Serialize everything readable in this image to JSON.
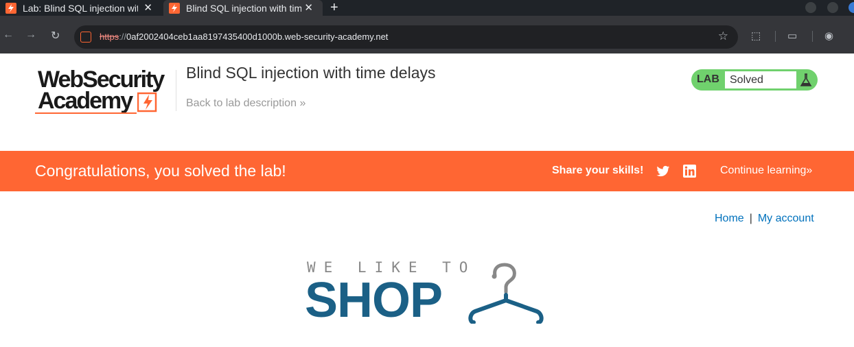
{
  "browser": {
    "tabs": [
      {
        "title": "Lab: Blind SQL injection with time delays",
        "active": false
      },
      {
        "title": "Blind SQL injection with time delays",
        "active": true
      }
    ],
    "url": {
      "scheme": "https",
      "separator": "://",
      "host": "0af2002404ceb1aa8197435400d1000b.web-security-academy.net"
    }
  },
  "header": {
    "logo_line1": "WebSecurity",
    "logo_line2": "Academy",
    "lab_title": "Blind SQL injection with time delays",
    "back_link": "Back to lab description",
    "badge": {
      "label": "LAB",
      "status": "Solved"
    }
  },
  "banner": {
    "message": "Congratulations, you solved the lab!",
    "share_label": "Share your skills!",
    "continue_label": "Continue learning"
  },
  "nav": {
    "home": "Home",
    "separator": "|",
    "account": "My account"
  },
  "shop_logo": {
    "tagline": "WE LIKE TO",
    "word": "SHOP"
  },
  "colors": {
    "brand_orange": "#ff6633",
    "lab_green": "#70d16d",
    "shop_blue": "#1b6086",
    "link_blue": "#0071bc"
  },
  "icons": [
    "back-arrow-icon",
    "forward-arrow-icon",
    "reload-icon",
    "star-icon",
    "extensions-icon",
    "profile-icon",
    "twitter-icon",
    "linkedin-icon",
    "flask-icon",
    "hanger-icon"
  ]
}
